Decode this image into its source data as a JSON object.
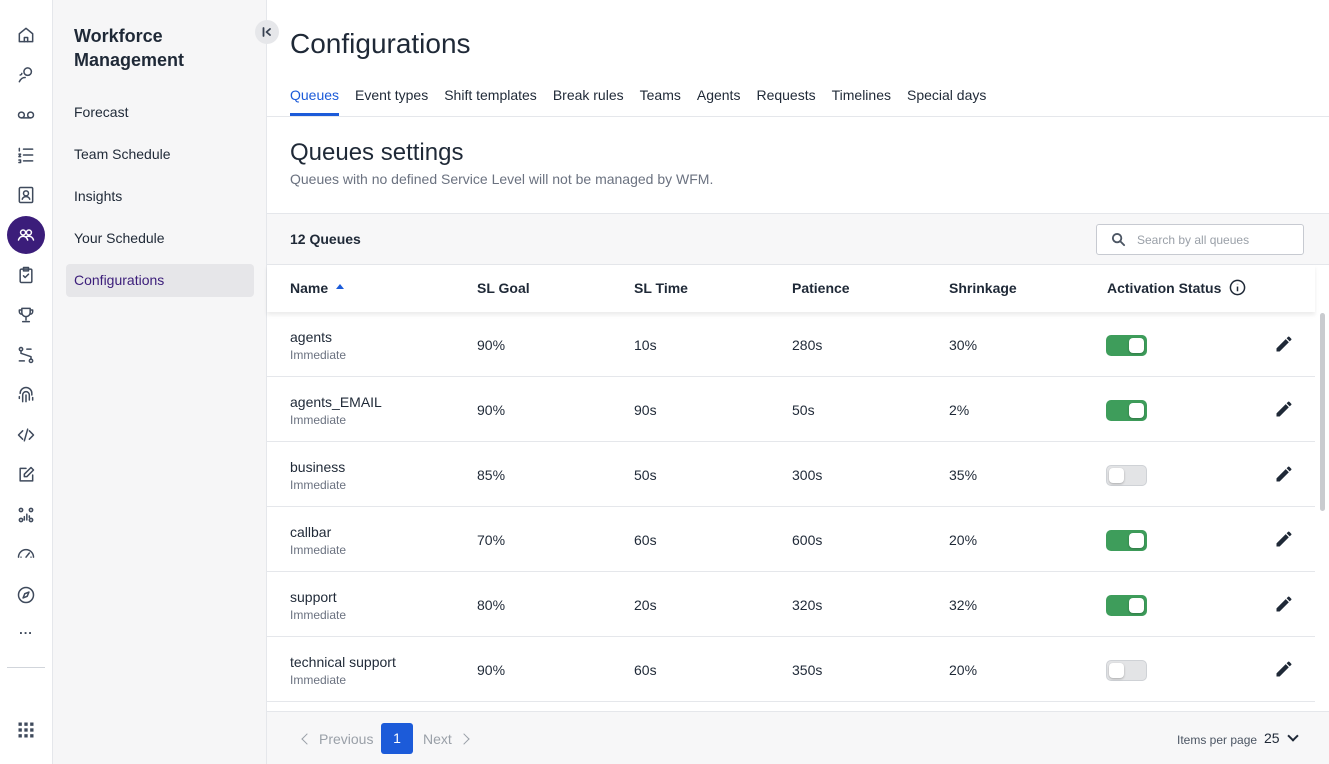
{
  "rail": {
    "icons": [
      "home-icon",
      "conversations-icon",
      "voicemail-icon",
      "list-icon",
      "contacts-icon",
      "workforce-icon",
      "clipboard-icon",
      "trophy-icon",
      "routing-icon",
      "fingerprint-icon",
      "code-icon",
      "edit-icon",
      "analytics-icon",
      "speedometer-icon",
      "compass-icon",
      "more-icon",
      "apps-grid-icon"
    ],
    "active": "workforce-icon",
    "more_label": "..."
  },
  "subnav": {
    "title": "Workforce Management",
    "items": [
      {
        "label": "Forecast"
      },
      {
        "label": "Team Schedule"
      },
      {
        "label": "Insights"
      },
      {
        "label": "Your Schedule"
      },
      {
        "label": "Configurations",
        "active": true
      }
    ]
  },
  "page": {
    "title": "Configurations",
    "tabs": [
      {
        "label": "Queues",
        "active": true
      },
      {
        "label": "Event types"
      },
      {
        "label": "Shift templates"
      },
      {
        "label": "Break rules"
      },
      {
        "label": "Teams"
      },
      {
        "label": "Agents"
      },
      {
        "label": "Requests"
      },
      {
        "label": "Timelines"
      },
      {
        "label": "Special days"
      }
    ]
  },
  "section": {
    "title": "Queues settings",
    "subtitle": "Queues with no defined Service Level will not be managed by WFM."
  },
  "toolbar": {
    "count_label": "12 Queues",
    "search_placeholder": "Search by all queues",
    "search_value": ""
  },
  "table": {
    "columns": [
      "Name",
      "SL Goal",
      "SL Time",
      "Patience",
      "Shrinkage",
      "Activation Status"
    ],
    "sorted_column": "Name",
    "sort_direction": "ascending",
    "rows": [
      {
        "name": "agents",
        "sub": "Immediate",
        "sl_goal": "90%",
        "sl_time": "10s",
        "patience": "280s",
        "shrinkage": "30%",
        "active": true
      },
      {
        "name": "agents_EMAIL",
        "sub": "Immediate",
        "sl_goal": "90%",
        "sl_time": "90s",
        "patience": "50s",
        "shrinkage": "2%",
        "active": true
      },
      {
        "name": "business",
        "sub": "Immediate",
        "sl_goal": "85%",
        "sl_time": "50s",
        "patience": "300s",
        "shrinkage": "35%",
        "active": false
      },
      {
        "name": "callbar",
        "sub": "Immediate",
        "sl_goal": "70%",
        "sl_time": "60s",
        "patience": "600s",
        "shrinkage": "20%",
        "active": true
      },
      {
        "name": "support",
        "sub": "Immediate",
        "sl_goal": "80%",
        "sl_time": "20s",
        "patience": "320s",
        "shrinkage": "32%",
        "active": true
      },
      {
        "name": "technical support",
        "sub": "Immediate",
        "sl_goal": "90%",
        "sl_time": "60s",
        "patience": "350s",
        "shrinkage": "20%",
        "active": false
      }
    ]
  },
  "pagination": {
    "previous_label": "Previous",
    "next_label": "Next",
    "current_page": "1",
    "items_per_page_label": "Items per page",
    "items_per_page_value": "25"
  },
  "colors": {
    "brand_active": "#3b1d7a",
    "link_blue": "#1c5bd9",
    "toggle_on": "#3e9d5b"
  }
}
